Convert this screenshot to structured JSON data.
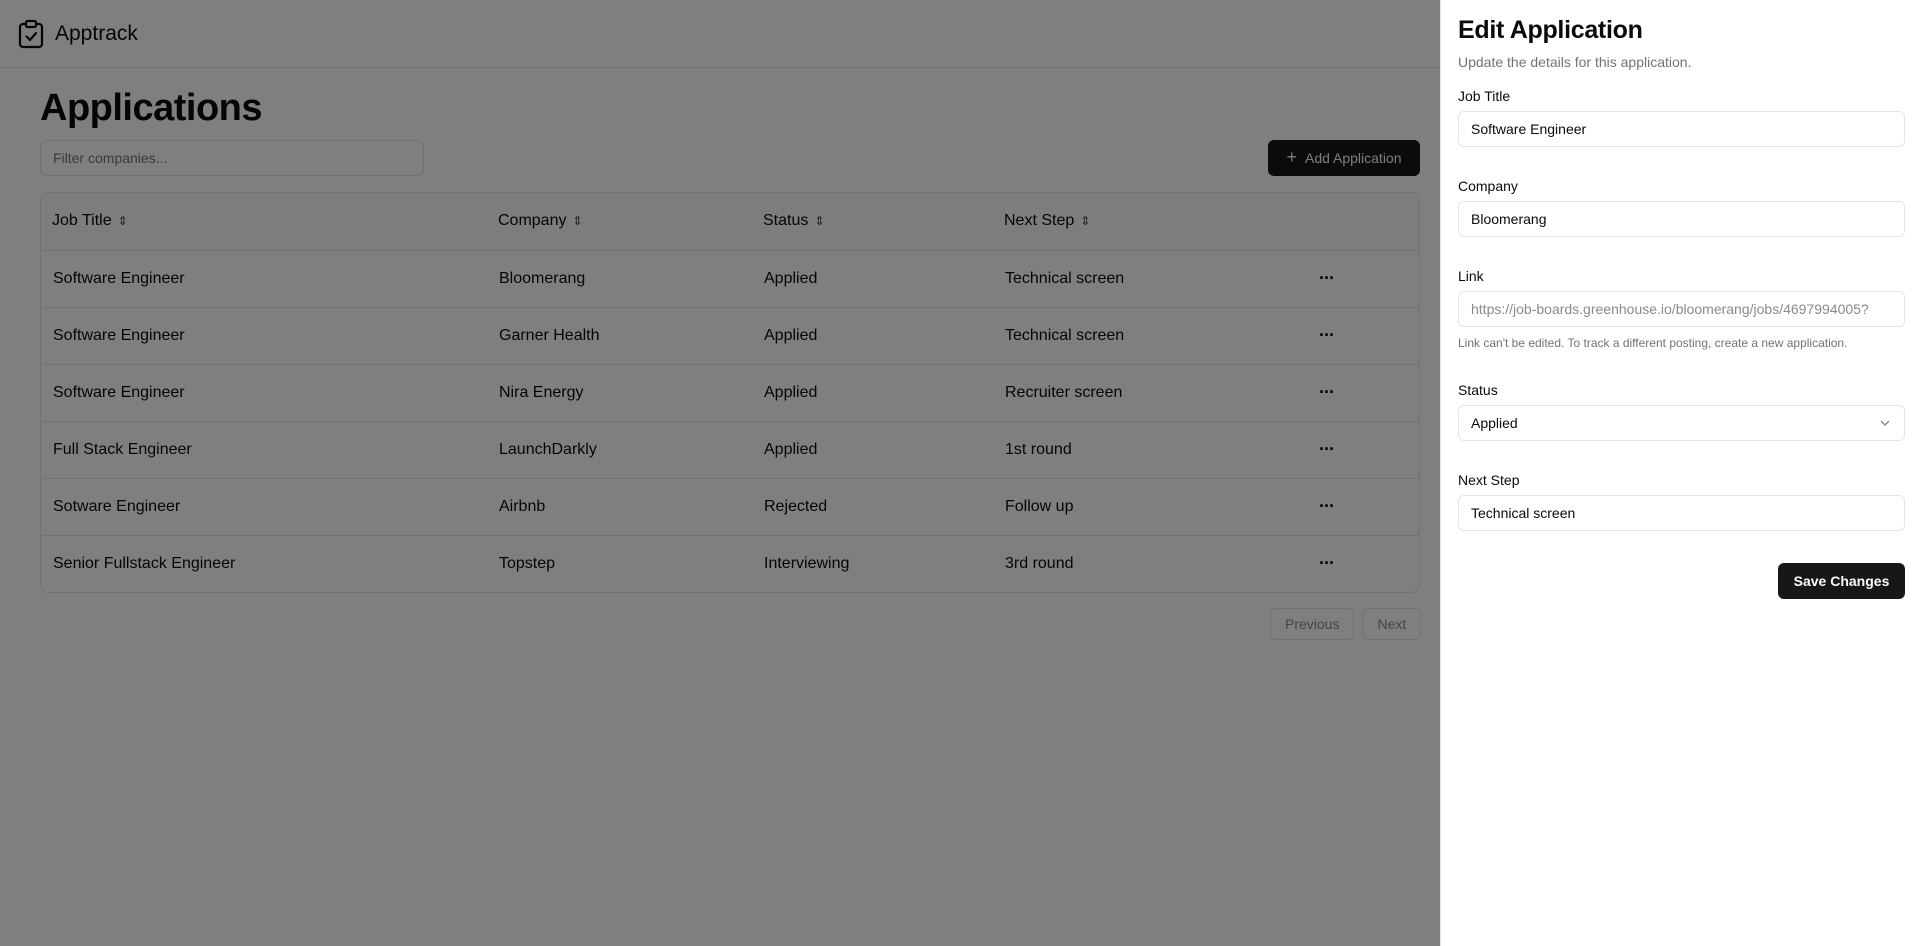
{
  "app": {
    "brand": "Apptrack"
  },
  "main": {
    "title": "Applications",
    "filter_placeholder": "Filter companies...",
    "add_label": "Add Application"
  },
  "table": {
    "headers": [
      "Job Title",
      "Company",
      "Status",
      "Next Step"
    ],
    "rows": [
      {
        "job": "Software Engineer",
        "company": "Bloomerang",
        "status": "Applied",
        "next": "Technical screen"
      },
      {
        "job": "Software Engineer",
        "company": "Garner Health",
        "status": "Applied",
        "next": "Technical screen"
      },
      {
        "job": "Software Engineer",
        "company": "Nira Energy",
        "status": "Applied",
        "next": "Recruiter screen"
      },
      {
        "job": "Full Stack Engineer",
        "company": "LaunchDarkly",
        "status": "Applied",
        "next": "1st round"
      },
      {
        "job": "Sotware Engineer",
        "company": "Airbnb",
        "status": "Rejected",
        "next": "Follow up"
      },
      {
        "job": "Senior Fullstack Engineer",
        "company": "Topstep",
        "status": "Interviewing",
        "next": "3rd round"
      }
    ],
    "row_menu_glyph": "···"
  },
  "pagination": {
    "previous": "Previous",
    "next": "Next"
  },
  "sheet": {
    "title": "Edit Application",
    "description": "Update the details for this application.",
    "job_title_label": "Job Title",
    "job_title_value": "Software Engineer",
    "company_label": "Company",
    "company_value": "Bloomerang",
    "link_label": "Link",
    "link_value": "https://job-boards.greenhouse.io/bloomerang/jobs/4697994005?",
    "link_help": "Link can't be edited. To track a different posting, create a new application.",
    "status_label": "Status",
    "status_value": "Applied",
    "next_step_label": "Next Step",
    "next_step_value": "Technical screen",
    "save_label": "Save Changes"
  },
  "colors": {
    "primary": "#171717",
    "overlay": "rgba(0,0,0,0.5)",
    "border": "#e5e5e5",
    "muted_text": "#737373"
  },
  "icons": {
    "logo": "clipboard-check-icon",
    "add": "plus-icon",
    "sort": "chevrons-up-down-icon",
    "row_menu": "more-horizontal-icon",
    "select": "chevron-down-icon"
  }
}
